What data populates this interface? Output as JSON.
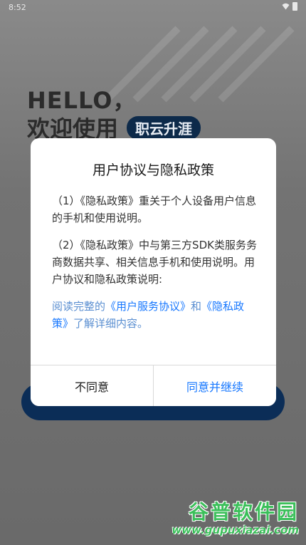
{
  "status_bar": {
    "time": "8:52"
  },
  "background": {
    "hello": "HELLO，",
    "welcome": "欢迎使用",
    "brand": "职云升涯"
  },
  "dialog": {
    "title": "用户协议与隐私政策",
    "paragraph1": "（1）《隐私政策》重关于个人设备用户信息的手机和使用说明。",
    "paragraph2": "（2）《隐私政策》中与第三方SDK类服务务商数据共享、相关信息手机和使用说明。用户协议和隐私政策说明:",
    "read_prefix": "阅读完整的",
    "user_agreement_link": "《用户服务协议》",
    "and": "和",
    "privacy_link": "《隐私政策》",
    "read_suffix": "了解详细内容。",
    "disagree_label": "不同意",
    "agree_label": "同意并继续"
  },
  "watermark": {
    "name": "谷普软件园",
    "url": "www.gupuxiazai.com"
  },
  "colors": {
    "link": "#1677ff",
    "brand_badge": "#0d2a4a",
    "watermark": "#3bbf5a"
  }
}
